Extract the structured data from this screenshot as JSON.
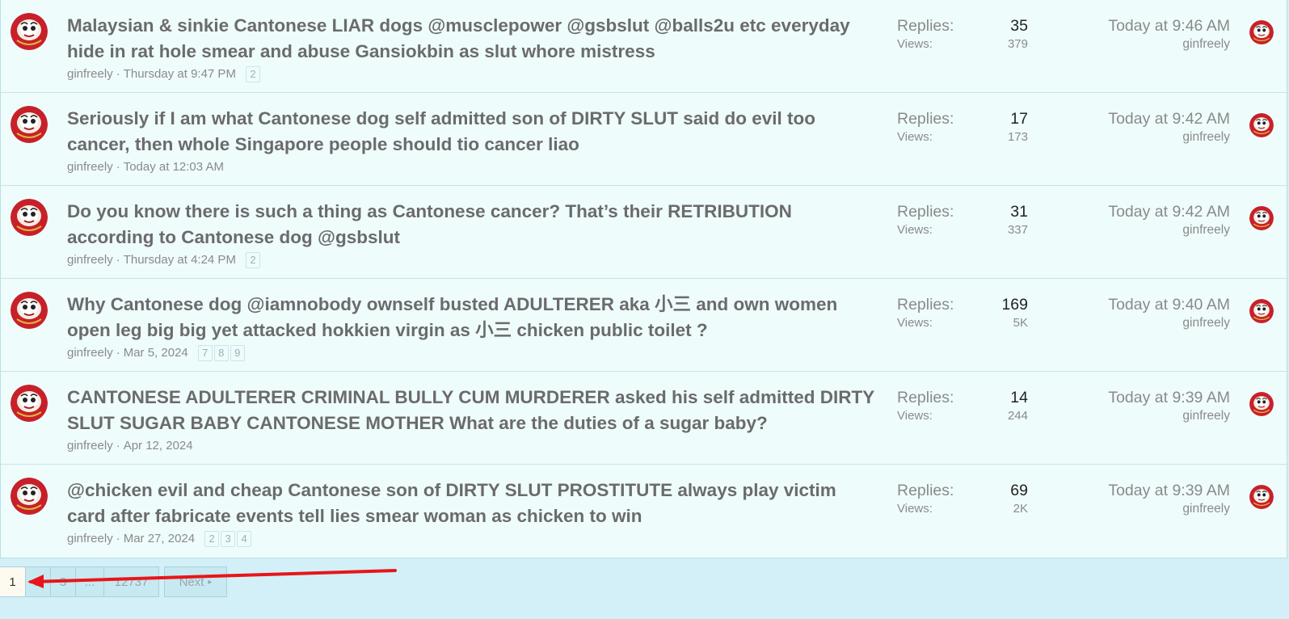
{
  "colors": {
    "accent": "#d8322e",
    "panel": "#effcfc",
    "title_text": "#6b6b6b"
  },
  "threads": [
    {
      "title": "Malaysian & sinkie Cantonese LIAR dogs @musclepower @gsbslut @balls2u etc everyday hide in rat hole smear and abuse Gansiokbin as slut whore mistress",
      "author": "ginfreely",
      "date": "Thursday at 9:47 PM",
      "pages": [
        "2"
      ],
      "replies_label": "Replies:",
      "replies": "35",
      "views_label": "Views:",
      "views": "379",
      "last_time": "Today at 9:46 AM",
      "last_user": "ginfreely"
    },
    {
      "title": "Seriously if I am what Cantonese dog self admitted son of DIRTY SLUT said do evil too cancer, then whole Singapore people should tio cancer liao",
      "author": "ginfreely",
      "date": "Today at 12:03 AM",
      "pages": [],
      "replies_label": "Replies:",
      "replies": "17",
      "views_label": "Views:",
      "views": "173",
      "last_time": "Today at 9:42 AM",
      "last_user": "ginfreely"
    },
    {
      "title": "Do you know there is such a thing as Cantonese cancer? That’s their RETRIBUTION according to Cantonese dog @gsbslut",
      "author": "ginfreely",
      "date": "Thursday at 4:24 PM",
      "pages": [
        "2"
      ],
      "replies_label": "Replies:",
      "replies": "31",
      "views_label": "Views:",
      "views": "337",
      "last_time": "Today at 9:42 AM",
      "last_user": "ginfreely"
    },
    {
      "title": "Why Cantonese dog @iamnobody ownself busted ADULTERER aka 小三 and own women open leg big big yet attacked hokkien virgin as 小三 chicken public toilet ?",
      "author": "ginfreely",
      "date": "Mar 5, 2024",
      "pages": [
        "7",
        "8",
        "9"
      ],
      "replies_label": "Replies:",
      "replies": "169",
      "views_label": "Views:",
      "views": "5K",
      "last_time": "Today at 9:40 AM",
      "last_user": "ginfreely"
    },
    {
      "title": "CANTONESE ADULTERER CRIMINAL BULLY CUM MURDERER asked his self admitted DIRTY SLUT SUGAR BABY CANTONESE MOTHER What are the duties of a sugar baby?",
      "author": "ginfreely",
      "date": "Apr 12, 2024",
      "pages": [],
      "replies_label": "Replies:",
      "replies": "14",
      "views_label": "Views:",
      "views": "244",
      "last_time": "Today at 9:39 AM",
      "last_user": "ginfreely"
    },
    {
      "title": "@chicken evil and cheap Cantonese son of DIRTY SLUT PROSTITUTE always play victim card after fabricate events tell lies smear woman as chicken to win",
      "author": "ginfreely",
      "date": "Mar 27, 2024",
      "pages": [
        "2",
        "3",
        "4"
      ],
      "replies_label": "Replies:",
      "replies": "69",
      "views_label": "Views:",
      "views": "2K",
      "last_time": "Today at 9:39 AM",
      "last_user": "ginfreely"
    }
  ],
  "pagination": {
    "current": "1",
    "p2": "2",
    "p3": "3",
    "ellipsis": "...",
    "last": "12737",
    "next": "Next"
  },
  "avatar_icon": "daruma-avatar-icon",
  "annotation": "red-arrow"
}
